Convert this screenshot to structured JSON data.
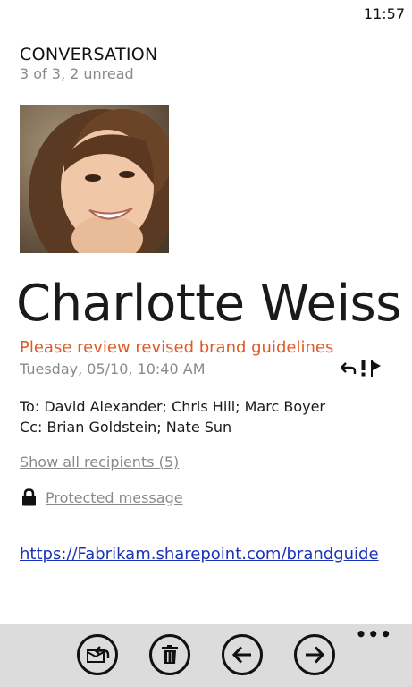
{
  "status_bar": {
    "time": "11:57"
  },
  "header": {
    "title": "CONVERSATION",
    "subtitle": "3 of 3, 2 unread"
  },
  "message": {
    "sender": "Charlotte Weiss",
    "subject": "Please review revised brand guidelines",
    "datetime": "Tuesday, 05/10, 10:40 AM",
    "to": "To: David Alexander; Chris Hill; Marc Boyer",
    "cc": "Cc: Brian Goldstein; Nate Sun",
    "show_all_recipients": "Show all recipients (5)",
    "protected_label": "Protected message",
    "link": "https://Fabrikam.sharepoint.com/brandguide"
  },
  "icons": {
    "reply": "reply-icon",
    "importance": "high-importance-icon",
    "flag": "flag-icon",
    "lock": "lock-icon"
  },
  "appbar": {
    "buttons": [
      "reply-all-icon",
      "delete-icon",
      "previous-icon",
      "next-icon"
    ],
    "more": "•••"
  },
  "colors": {
    "subject": "#e05a27",
    "link": "#1a33b8",
    "secondary_text": "#8a8a8a",
    "appbar_bg": "#dcdcdc"
  }
}
